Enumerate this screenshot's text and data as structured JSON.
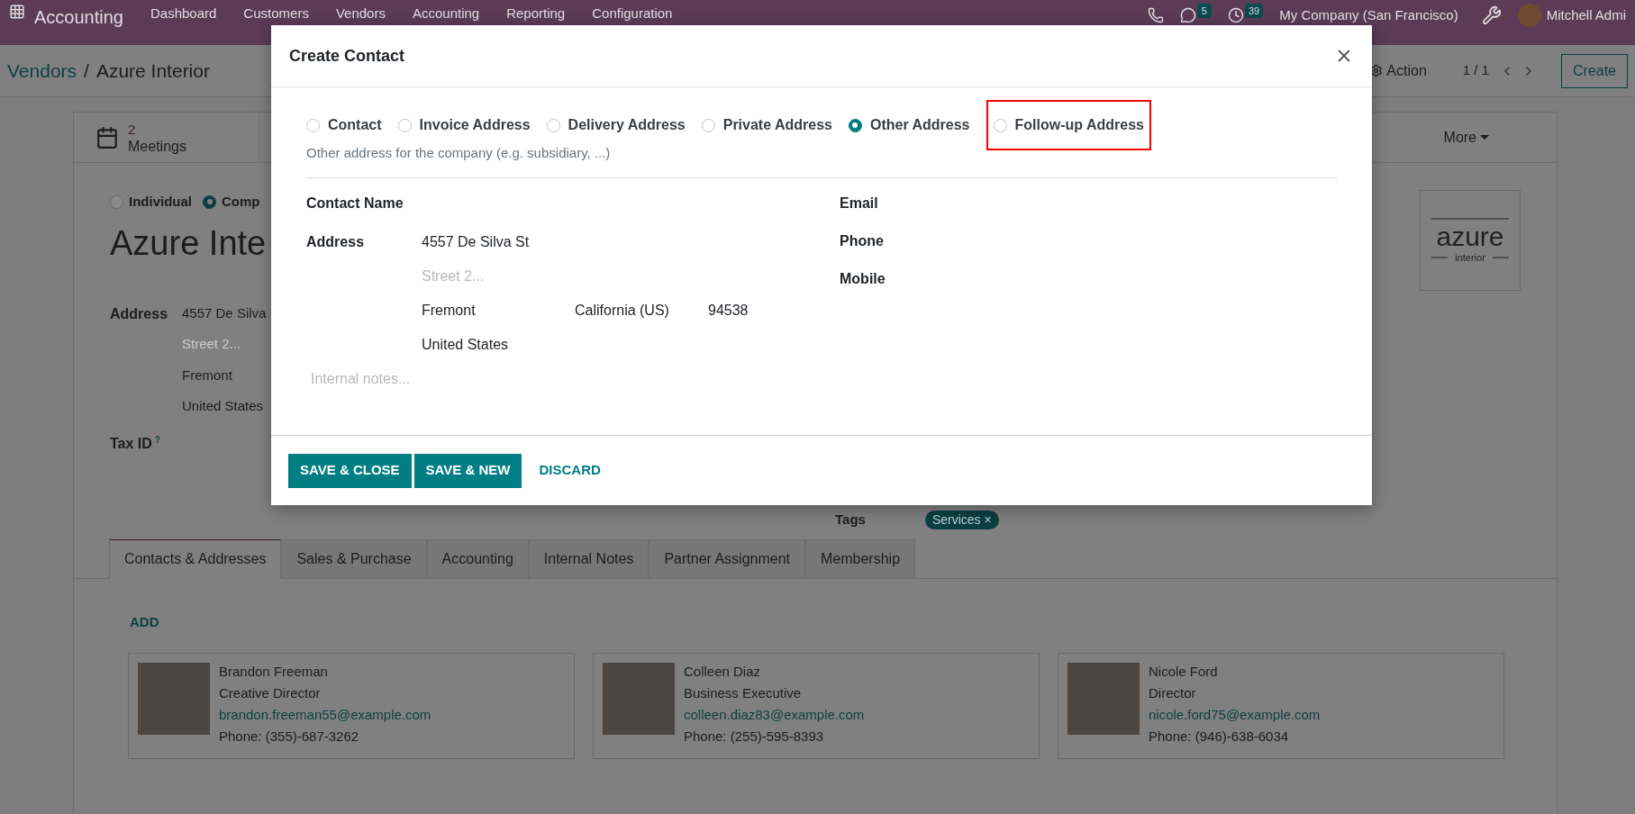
{
  "navbar": {
    "app": "Accounting",
    "menu": [
      "Dashboard",
      "Customers",
      "Vendors",
      "Accounting",
      "Reporting",
      "Configuration"
    ],
    "messages_count": "5",
    "activities_count": "39",
    "company": "My Company (San Francisco)",
    "user": "Mitchell Admi"
  },
  "control_panel": {
    "breadcrumb": [
      {
        "label": "Vendors",
        "kind": "link"
      },
      {
        "label": "Azure Interior",
        "kind": "current"
      }
    ],
    "separator": "/",
    "action": "Action",
    "pager": "1 / 1",
    "create": "Create"
  },
  "record": {
    "smart_button": {
      "count": "2",
      "label": "Meetings"
    },
    "more": "More",
    "company_types": [
      {
        "label": "Individual",
        "selected": false
      },
      {
        "label": "Comp",
        "selected": true
      }
    ],
    "name": "Azure Inte",
    "address_label": "Address",
    "address_lines": [
      {
        "text": "4557 De Silva",
        "placeholder": false
      },
      {
        "text": "Street 2...",
        "placeholder": true
      },
      {
        "text": "Fremont",
        "placeholder": false
      },
      {
        "text": "United States",
        "placeholder": false
      }
    ],
    "tax_label": "Tax ID",
    "tax_help": "?",
    "tags_label": "Tags",
    "tags": [
      {
        "label": "Services",
        "remove": "×"
      }
    ],
    "logo": {
      "word": "azure",
      "sub": "interior"
    }
  },
  "tabs": [
    {
      "label": "Contacts & Addresses",
      "selected": true
    },
    {
      "label": "Sales & Purchase",
      "selected": false
    },
    {
      "label": "Accounting",
      "selected": false
    },
    {
      "label": "Internal Notes",
      "selected": false
    },
    {
      "label": "Partner Assignment",
      "selected": false
    },
    {
      "label": "Membership",
      "selected": false
    }
  ],
  "add": "ADD",
  "contacts": [
    {
      "name": "Brandon Freeman",
      "title": "Creative Director",
      "email": "brandon.freeman55@example.com",
      "phone": "Phone: (355)-687-3262"
    },
    {
      "name": "Colleen Diaz",
      "title": "Business Executive",
      "email": "colleen.diaz83@example.com",
      "phone": "Phone: (255)-595-8393"
    },
    {
      "name": "Nicole Ford",
      "title": "Director",
      "email": "nicole.ford75@example.com",
      "phone": "Phone: (946)-638-6034"
    }
  ],
  "dialog": {
    "title": "Create Contact",
    "types": [
      {
        "label": "Contact",
        "selected": false,
        "highlighted": false
      },
      {
        "label": "Invoice Address",
        "selected": false,
        "highlighted": false
      },
      {
        "label": "Delivery Address",
        "selected": false,
        "highlighted": false
      },
      {
        "label": "Private Address",
        "selected": false,
        "highlighted": false
      },
      {
        "label": "Other Address",
        "selected": true,
        "highlighted": false
      },
      {
        "label": "Follow-up Address",
        "selected": false,
        "highlighted": true
      }
    ],
    "description": "Other address for the company (e.g. subsidiary, ...)",
    "contact_name_label": "Contact Name",
    "address_label": "Address",
    "address": {
      "street": "4557 De Silva St",
      "street2_placeholder": "Street 2...",
      "city": "Fremont",
      "state": "California (US)",
      "zip": "94538",
      "country": "United States"
    },
    "right_fields": [
      "Email",
      "Phone",
      "Mobile"
    ],
    "notes_placeholder": "Internal notes...",
    "buttons": [
      {
        "label": "SAVE & CLOSE",
        "kind": "primary"
      },
      {
        "label": "SAVE & NEW",
        "kind": "primary"
      },
      {
        "label": "DISCARD",
        "kind": "link"
      }
    ]
  }
}
